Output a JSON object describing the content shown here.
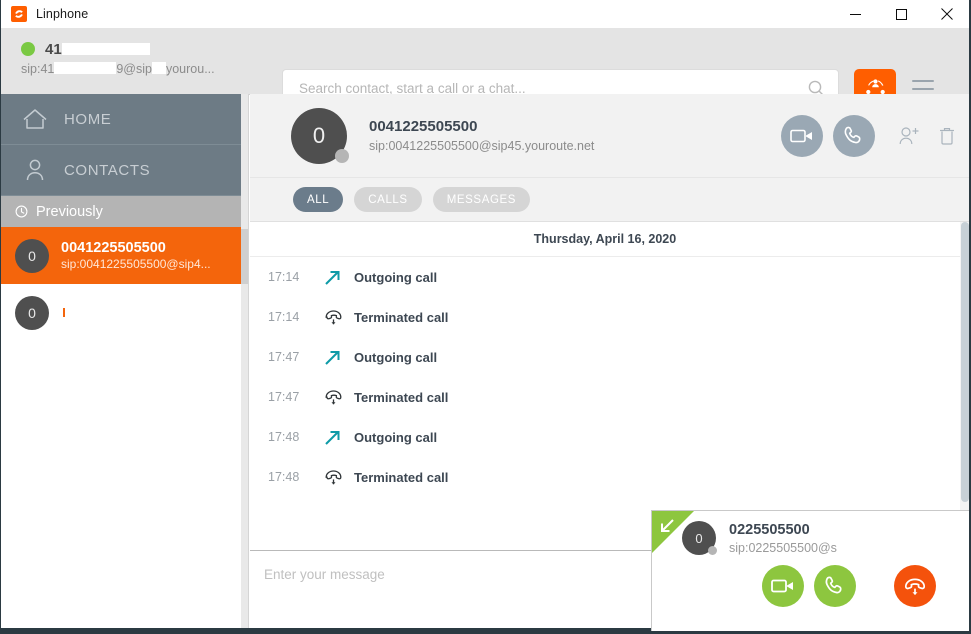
{
  "window": {
    "title": "Linphone",
    "app_icon": "linphone-icon",
    "minimize_label": "minimize",
    "maximize_label": "maximize",
    "close_label": "close"
  },
  "account": {
    "name_prefix": "41",
    "sip_prefix": "sip:41",
    "sip_mid": "9@sip",
    "sip_suffix": "yourou...",
    "status": "online",
    "status_color": "#7ac943"
  },
  "search": {
    "placeholder": "Search contact, start a call or a chat...",
    "value": "",
    "icon": "search-icon"
  },
  "toolbar": {
    "conference_icon": "conference-icon",
    "conference_color": "#ff5e00",
    "menu_icon": "hamburger-menu-icon"
  },
  "sidebar": {
    "nav": [
      {
        "label": "HOME",
        "icon": "home-icon"
      },
      {
        "label": "CONTACTS",
        "icon": "contacts-icon"
      }
    ],
    "section": {
      "label": "Previously",
      "icon": "clock-icon"
    },
    "contacts": [
      {
        "avatar": "0",
        "name": "0041225505500",
        "sip": "sip:0041225505500@sip4...",
        "selected": true
      },
      {
        "avatar": "0",
        "name": "",
        "sip": "",
        "selected": false
      }
    ]
  },
  "chat_header": {
    "avatar": "0",
    "name": "0041225505500",
    "sip": "sip:0041225505500@sip45.youroute.net",
    "presence_color": "#b5b5b5",
    "actions": [
      {
        "name": "video-call-button",
        "icon": "video-camera-icon"
      },
      {
        "name": "audio-call-button",
        "icon": "phone-handset-icon"
      },
      {
        "name": "add-contact-button",
        "icon": "add-person-icon"
      },
      {
        "name": "delete-history-button",
        "icon": "trash-icon"
      }
    ]
  },
  "filters": [
    {
      "label": "ALL",
      "active": true
    },
    {
      "label": "CALLS",
      "active": false
    },
    {
      "label": "MESSAGES",
      "active": false
    }
  ],
  "conversation": {
    "date": "Thursday, April 16, 2020",
    "events": [
      {
        "time": "17:14",
        "label": "Outgoing call",
        "icon": "outgoing-call-arrow-icon"
      },
      {
        "time": "17:14",
        "label": "Terminated call",
        "icon": "terminated-call-icon"
      },
      {
        "time": "17:47",
        "label": "Outgoing call",
        "icon": "outgoing-call-arrow-icon"
      },
      {
        "time": "17:47",
        "label": "Terminated call",
        "icon": "terminated-call-icon"
      },
      {
        "time": "17:48",
        "label": "Outgoing call",
        "icon": "outgoing-call-arrow-icon"
      },
      {
        "time": "17:48",
        "label": "Terminated call",
        "icon": "terminated-call-icon"
      }
    ]
  },
  "composer": {
    "placeholder": "Enter your message",
    "value": ""
  },
  "incoming_call": {
    "direction_icon": "incoming-call-arrow-icon",
    "flag_color": "#8dc63f",
    "avatar": "0",
    "name": "0225505500",
    "sip": "sip:0225505500@s",
    "buttons": [
      {
        "name": "answer-video-button",
        "icon": "video-camera-icon",
        "color": "#8dc63f"
      },
      {
        "name": "answer-audio-button",
        "icon": "phone-handset-icon",
        "color": "#8dc63f"
      },
      {
        "name": "decline-call-button",
        "icon": "hangup-icon",
        "color": "#f4520c"
      }
    ]
  },
  "colors": {
    "accent_orange": "#ff5e00",
    "selected_orange": "#f4650c",
    "nav_slate": "#6d7b85",
    "teal_arrow": "#0e9aa7",
    "green": "#8dc63f"
  }
}
